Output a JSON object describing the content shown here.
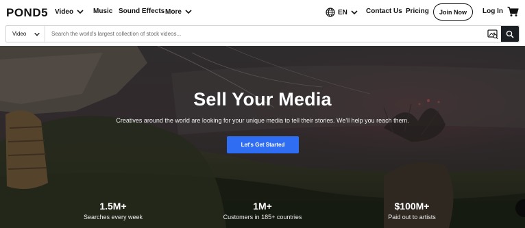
{
  "nav": {
    "logo": "POND5",
    "video": "Video",
    "music": "Music",
    "sound_effects": "Sound Effects",
    "more": "More",
    "language": "EN",
    "contact": "Contact Us",
    "pricing": "Pricing",
    "join": "Join Now",
    "login": "Log In"
  },
  "search": {
    "type_selected": "Video",
    "placeholder": "Search the world's largest collection of stock videos..."
  },
  "hero": {
    "title": "Sell Your Media",
    "subtitle": "Creatives around the world are looking for your unique media to tell their stories. We'll help you reach them.",
    "cta": "Let's Get Started"
  },
  "stats": [
    {
      "value": "1.5M+",
      "label": "Searches every week"
    },
    {
      "value": "1M+",
      "label": "Customers in 185+ countries"
    },
    {
      "value": "$100M+",
      "label": "Paid out to artists"
    }
  ],
  "colors": {
    "accent": "#2f6ef2",
    "search_button": "#1b1f23",
    "text": "#111111"
  },
  "icons": {
    "language": "globe-icon",
    "cart": "cart-icon",
    "visual_search": "visual-search-icon",
    "search": "search-icon"
  }
}
